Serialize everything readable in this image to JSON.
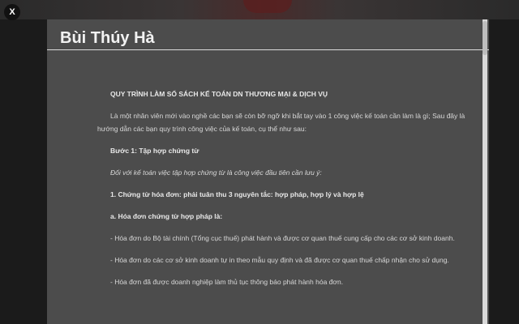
{
  "close_button": {
    "label": "X"
  },
  "modal": {
    "title": "Bùi Thúy Hà",
    "heading": "QUY TRÌNH LÀM SỔ SÁCH KẾ TOÁN DN THƯƠNG MẠI & DỊCH VỤ",
    "intro": "Là một nhân viên mới vào nghề các bạn sẽ còn bỡ ngỡ khi bắt tay vào 1 công việc kế toán cần làm là gì; Sau đây là hướng dẫn các bạn quy trình công việc của kế toán, cụ thể như sau:",
    "step1": "Bước 1: Tập hợp chứng từ",
    "step1_note": "Đối với kế toán việc tập hợp chứng từ là công việc đầu tiên cần lưu ý:",
    "section1": "1. Chứng từ hóa đơn: phải tuân thu 3 nguyên tắc: hợp pháp, hợp lý và hợp lệ",
    "section_a": "a. Hóa đơn chứng từ hợp pháp là:",
    "item1": "- Hóa đơn do Bộ tài chính (Tổng cục thuế) phát hành và được cơ quan thuế cung cấp cho các cơ sở kinh doanh.",
    "item2": "- Hóa đơn do các cơ sở kinh doanh tự in theo mẫu quy định và đã được cơ quan thuế chấp nhận cho sử dụng.",
    "item3": "- Hóa đơn đã được doanh nghiệp làm thủ tục thông báo phát hành hóa đơn."
  }
}
